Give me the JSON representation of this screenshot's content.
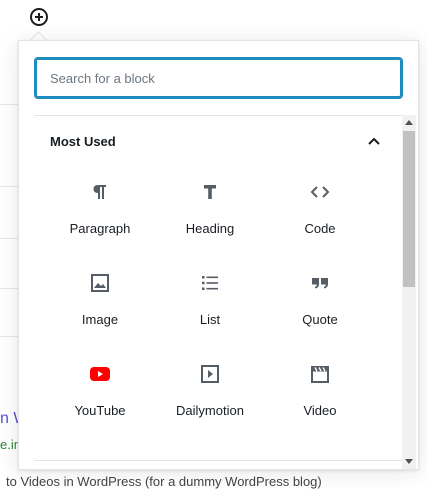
{
  "background": {
    "link_fragment": "n W",
    "url_fragment": "e.in",
    "text_fragment": "to Videos in WordPress (for a dummy WordPress blog)"
  },
  "inserter": {
    "toggle_icon": "plus-circle-icon",
    "search_placeholder": "Search for a block"
  },
  "panel": {
    "title": "Most Used",
    "collapse_icon": "chevron-up-icon"
  },
  "blocks": [
    {
      "label": "Paragraph",
      "icon": "paragraph-icon"
    },
    {
      "label": "Heading",
      "icon": "heading-icon"
    },
    {
      "label": "Code",
      "icon": "code-icon"
    },
    {
      "label": "Image",
      "icon": "image-icon"
    },
    {
      "label": "List",
      "icon": "list-icon"
    },
    {
      "label": "Quote",
      "icon": "quote-icon"
    },
    {
      "label": "YouTube",
      "icon": "youtube-icon"
    },
    {
      "label": "Dailymotion",
      "icon": "video-play-icon"
    },
    {
      "label": "Video",
      "icon": "video-clapper-icon"
    }
  ],
  "colors": {
    "accent": "#1e8cbe",
    "youtube": "#ff0000",
    "icon": "#555d66"
  }
}
